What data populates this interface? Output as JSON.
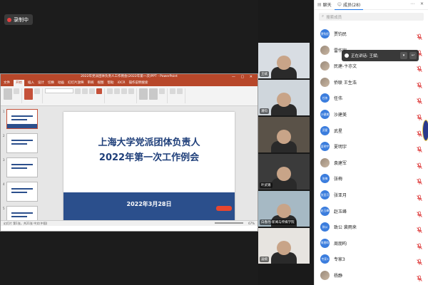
{
  "recording": {
    "label": "录制中"
  },
  "ppt": {
    "title": "2022年党派团体负责人工作例会(2022年第一次)PPT - PowerPoint",
    "tabs": [
      "文件",
      "开始",
      "插入",
      "设计",
      "切换",
      "动画",
      "幻灯片放映",
      "审阅",
      "视图",
      "帮助",
      "iOCR",
      "操作说明搜索"
    ],
    "active_tab": "开始",
    "slide_title_line1": "上海大学党派团体负责人",
    "slide_title_line2": "2022年第一次工作例会",
    "slide_date": "2022年3月28日",
    "thumbnails": [
      "1",
      "2",
      "3",
      "4",
      "5",
      "6"
    ],
    "status_left": "幻灯片 第1张，共21张 中文(中国)",
    "zoom": "67%"
  },
  "videos": [
    {
      "name": "王斌"
    },
    {
      "name": "潘钧"
    },
    {
      "name": ""
    },
    {
      "name": "叶武锡"
    },
    {
      "name": "白春丹-新闻与传媒学院"
    },
    {
      "name": "凌婉"
    }
  ],
  "panel": {
    "tab_chat": "聊天",
    "tab_members": "成员(28)",
    "search_placeholder": "搜索成员",
    "speaking_text": "正在讲话: 王斌;",
    "members": [
      {
        "avatar": "贾钧民",
        "name": "贾钧民",
        "color": "#3b7ddd",
        "photo": false
      },
      {
        "avatar": "",
        "name": "雷作宇",
        "color": "#9a8a7a",
        "photo": true
      },
      {
        "avatar": "",
        "name": "民建-卞亦文",
        "color": "#9a8a7a",
        "photo": true
      },
      {
        "avatar": "",
        "name": "侨联 王生浩",
        "color": "#9a8a7a",
        "photo": true
      },
      {
        "avatar": "任伟",
        "name": "任伟",
        "color": "#3b7ddd",
        "photo": false
      },
      {
        "avatar": "沙建美",
        "name": "沙建美",
        "color": "#3b7ddd",
        "photo": false
      },
      {
        "avatar": "武星",
        "name": "武星",
        "color": "#3b7ddd",
        "photo": false
      },
      {
        "avatar": "夏明宇",
        "name": "夏明宇",
        "color": "#3b7ddd",
        "photo": false
      },
      {
        "avatar": "",
        "name": "袁建军",
        "color": "#9a8a7a",
        "photo": true
      },
      {
        "avatar": "张梅",
        "name": "张梅",
        "color": "#3b7ddd",
        "photo": false
      },
      {
        "avatar": "张亚月",
        "name": "张亚月",
        "color": "#3b7ddd",
        "photo": false
      },
      {
        "avatar": "赵玉峰",
        "name": "赵玉峰",
        "color": "#3b7ddd",
        "photo": false
      },
      {
        "avatar": "致公",
        "name": "致公 裴雨来",
        "color": "#3b7ddd",
        "photo": false
      },
      {
        "avatar": "周朋昀",
        "name": "周朋昀",
        "color": "#3b7ddd",
        "photo": false
      },
      {
        "avatar": "专家3",
        "name": "专家3",
        "color": "#3b7ddd",
        "photo": false
      },
      {
        "avatar": "",
        "name": "杨静",
        "color": "#9a8a7a",
        "photo": true
      }
    ]
  }
}
